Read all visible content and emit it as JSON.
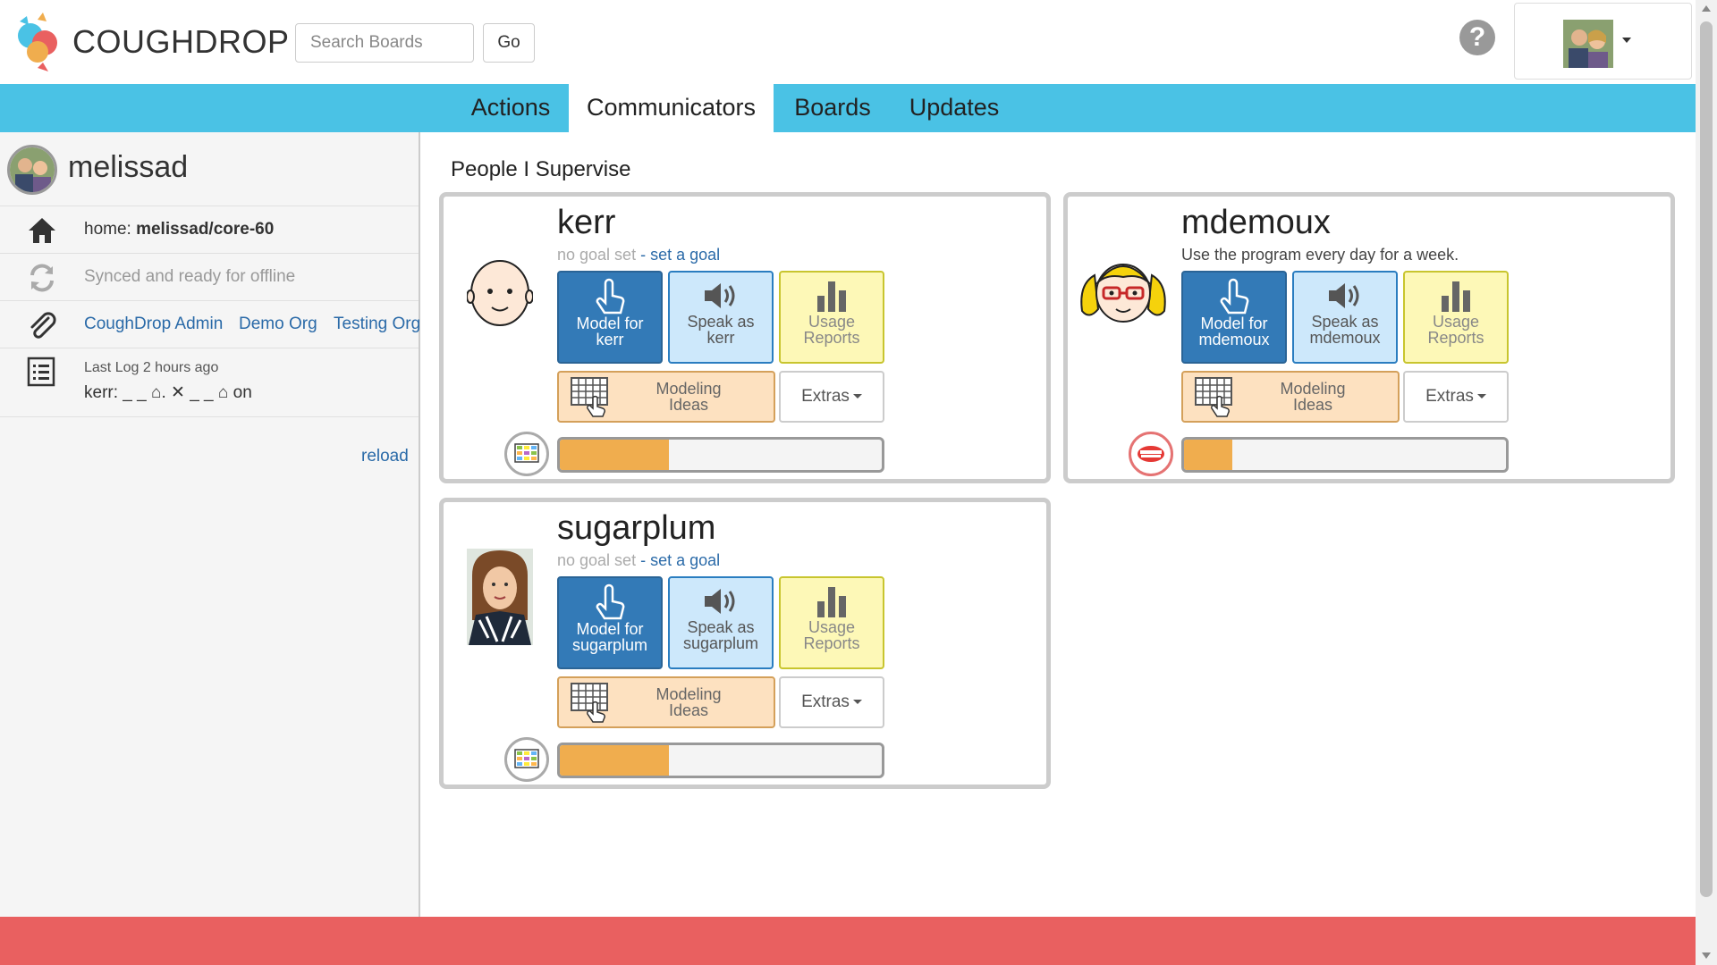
{
  "header": {
    "brand": "COUGHDROP",
    "search_placeholder": "Search Boards",
    "go_label": "Go",
    "help_label": "?"
  },
  "nav": {
    "tabs": [
      {
        "label": "Actions",
        "active": false
      },
      {
        "label": "Communicators",
        "active": true
      },
      {
        "label": "Boards",
        "active": false
      },
      {
        "label": "Updates",
        "active": false
      }
    ]
  },
  "sidebar": {
    "username": "melissad",
    "home_prefix": "home:",
    "home_board": "melissad/core-60",
    "sync_status": "Synced and ready for offline",
    "orgs": [
      "CoughDrop Admin",
      "Demo Org",
      "Testing Org"
    ],
    "last_log_label": "Last Log 2 hours ago",
    "last_log_text": "kerr: _ _ ⌂. ✕ _ _ ⌂ on",
    "reload_label": "reload"
  },
  "main": {
    "title": "People I Supervise",
    "communicators": [
      {
        "name": "kerr",
        "goal": "no goal set",
        "goal_link": "- set a goal",
        "model_label": "Model for kerr",
        "speak_label": "Speak as kerr",
        "usage_label": "Usage Reports",
        "modeling_label": "Modeling Ideas",
        "extras_label": "Extras",
        "progress": 0.34
      },
      {
        "name": "mdemoux",
        "goal": "Use the program every day for a week.",
        "goal_link": "",
        "model_label": "Model for mdemoux",
        "speak_label": "Speak as mdemoux",
        "usage_label": "Usage Reports",
        "modeling_label": "Modeling Ideas",
        "extras_label": "Extras",
        "progress": 0.15
      },
      {
        "name": "sugarplum",
        "goal": "no goal set",
        "goal_link": "- set a goal",
        "model_label": "Model for sugarplum",
        "speak_label": "Speak as sugarplum",
        "usage_label": "Usage Reports",
        "modeling_label": "Modeling Ideas",
        "extras_label": "Extras",
        "progress": 0.34
      }
    ]
  },
  "colors": {
    "nav_bg": "#4ac2e5",
    "footer_bg": "#e96060",
    "model_btn": "#337ab7",
    "speak_btn": "#cde8fb",
    "usage_btn": "#fdf8b7",
    "modeling_btn": "#fde1c0",
    "progress_fill": "#f0ad4e"
  }
}
